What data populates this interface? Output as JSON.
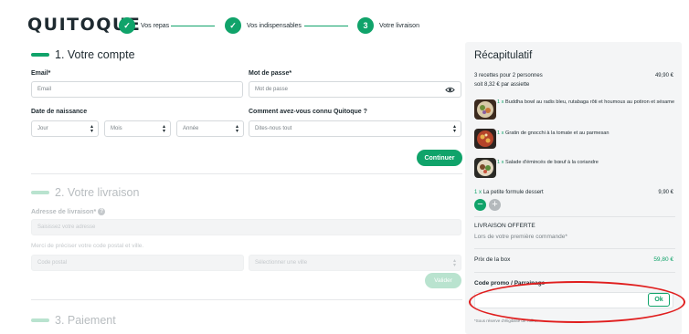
{
  "header": {
    "logo": "QUITOQUE",
    "steps": [
      {
        "icon": "check-icon",
        "number": "",
        "label": "Vos repas"
      },
      {
        "icon": "check-icon",
        "number": "",
        "label": "Vos indispensables"
      },
      {
        "icon": "",
        "number": "3",
        "label": "Votre livraison"
      }
    ]
  },
  "account": {
    "title": "1. Votre compte",
    "email_label": "Email*",
    "email_placeholder": "Email",
    "password_label": "Mot de passe*",
    "password_placeholder": "Mot de passe",
    "birth_label": "Date de naissance",
    "day": "Jour",
    "month": "Mois",
    "year": "Année",
    "source_label": "Comment avez-vous connu Quitoque ?",
    "source_value": "Dites-nous tout",
    "continue_label": "Continuer"
  },
  "delivery": {
    "title": "2. Votre livraison",
    "address_label": "Adresse de livraison*",
    "address_placeholder": "Saisissez votre adresse",
    "hint": "Merci de préciser votre code postal et ville.",
    "postal_placeholder": "Code postal",
    "city_placeholder": "Sélectionner une ville",
    "validate_label": "Valider"
  },
  "payment": {
    "title": "3. Paiement"
  },
  "summary": {
    "title": "Récapitulatif",
    "recipes_line": "3 recettes pour 2 personnes",
    "recipes_price": "49,90 €",
    "per_plate": "soit 8,32 € par assiette",
    "items": [
      {
        "qty": "1 x",
        "name": "Buddha bowl au radis bleu, rutabaga rôti et houmous au potiron et sésame"
      },
      {
        "qty": "1 x",
        "name": "Gratin de gnocchi à la tomate et au parmesan"
      },
      {
        "qty": "1 x",
        "name": "Salade d'émincés de bœuf à la coriandre"
      }
    ],
    "dessert_qty": "1 x",
    "dessert_name": "La petite formule dessert",
    "dessert_price": "9,90 €",
    "minus": "−",
    "plus": "+",
    "delivery_title": "LIVRAISON OFFERTE",
    "delivery_sub": "Lors de votre première commande*",
    "box_label": "Prix de la box",
    "box_price": "59,80 €",
    "promo_label": "Code promo / Parrainage",
    "ok_label": "Ok",
    "footnote": "*Sous réserve d'éligibilité de l'offre."
  },
  "colors": {
    "brand_green": "#10a36a",
    "annotation_red": "#e01e1e"
  }
}
